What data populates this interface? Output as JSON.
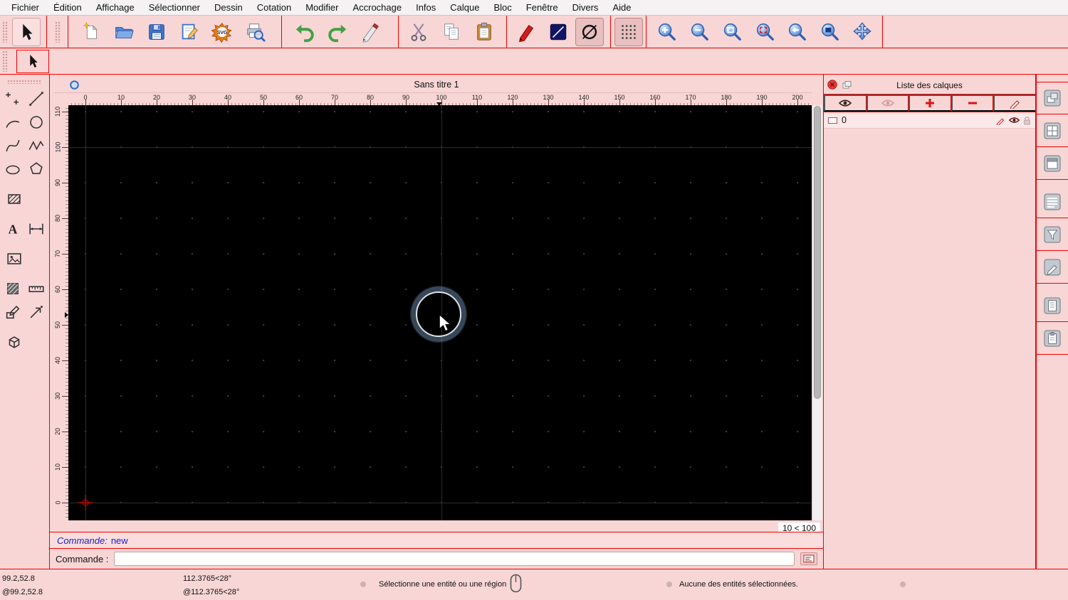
{
  "menu_bar": {
    "items": [
      "Fichier",
      "Édition",
      "Affichage",
      "Sélectionner",
      "Dessin",
      "Cotation",
      "Modifier",
      "Accrochage",
      "Infos",
      "Calque",
      "Bloc",
      "Fenêtre",
      "Divers",
      "Aide"
    ]
  },
  "toolbar": {
    "icons": [
      "select-arrow",
      "new-document",
      "open-folder",
      "save",
      "save-as",
      "svg-export",
      "print-preview",
      "undo",
      "redo",
      "pen-edit",
      "cut",
      "copy",
      "paste",
      "pen-attributes",
      "line-attributes",
      "circle-attributes",
      "grid-toggle",
      "zoom-in",
      "zoom-out",
      "zoom-auto",
      "zoom-previous",
      "zoom-pan",
      "zoom-window",
      "pan-view"
    ]
  },
  "tool_palette": {
    "icons": [
      "points",
      "line",
      "arc",
      "circle",
      "spline",
      "polyline",
      "ellipse",
      "polygon",
      "hatch",
      "text",
      "dimension",
      "image",
      "order",
      "measure",
      "modify",
      "snap",
      "solid"
    ]
  },
  "document_window": {
    "title": "Sans titre 1",
    "zoom_indicator": "10 < 100",
    "h_ruler_labels": [
      "0",
      "10",
      "20",
      "30",
      "40",
      "50",
      "60",
      "70",
      "80",
      "90",
      "100",
      "110",
      "120",
      "130",
      "140",
      "150",
      "160",
      "170",
      "180",
      "190",
      "200"
    ],
    "v_ruler_labels": [
      "110",
      "100",
      "90",
      "80",
      "70",
      "60",
      "50",
      "40",
      "30",
      "20",
      "10",
      "0"
    ]
  },
  "command_panel": {
    "history_label": "Commande:",
    "history_value": "new",
    "prompt_label": "Commande :",
    "input_value": ""
  },
  "layers_panel": {
    "title": "Liste des calques",
    "toolbar_icons": [
      "show-all-layers-eye",
      "hide-construction-eye",
      "add-layer-plus",
      "remove-layer-minus",
      "edit-layer-pencil"
    ],
    "rows": [
      {
        "name": "0"
      }
    ]
  },
  "side_dock": {
    "icons": [
      "layers-dock",
      "blocks-dock",
      "window-dock",
      "list-dock",
      "filter-dock",
      "pen-dock",
      "document-dock",
      "clipboard-dock"
    ]
  },
  "status_bar": {
    "absolute_coordinates": "99.2,52.8",
    "relative_coordinates": "@99.2,52.8",
    "absolute_polar": "112.3765<28°",
    "relative_polar": "@112.3765<28°",
    "hint": "Sélectionne une entité ou une région",
    "selection_status": "Aucune des entités sélectionnées."
  },
  "colors": {
    "window_pink": "#f8d6d6",
    "divider_red": "#f20000",
    "canvas_black": "#000000",
    "command_text_blue": "#1c1ccc",
    "accent_blue": "#3a72c8",
    "accent_green": "#44a044",
    "accent_red": "#cc1111"
  }
}
